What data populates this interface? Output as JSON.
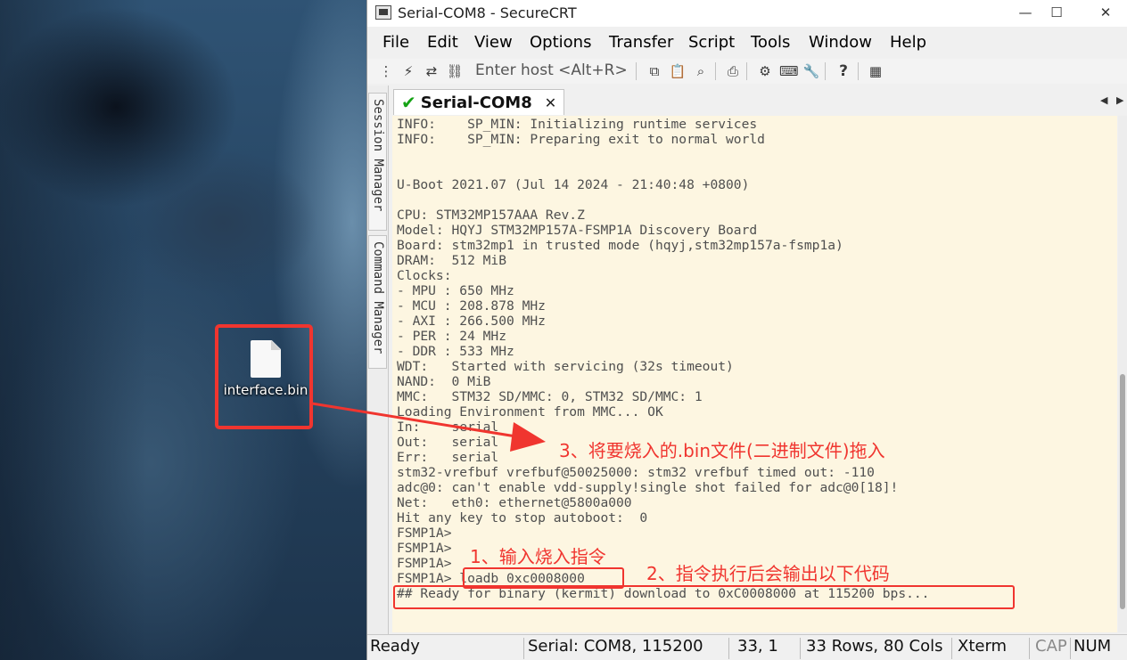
{
  "desktop": {
    "file_name": "interface.bin",
    "file_icon": "blank-file-icon"
  },
  "window": {
    "title": "Serial-COM8 - SecureCRT",
    "minimize_glyph": "—",
    "maximize_glyph": "☐",
    "close_glyph": "✕"
  },
  "menu": [
    "File",
    "Edit",
    "View",
    "Options",
    "Transfer",
    "Script",
    "Tools",
    "Window",
    "Help"
  ],
  "toolbar": {
    "host_placeholder": "Enter host <Alt+R>",
    "icons": {
      "connect": "⋮",
      "quick_connect": "⚡",
      "reconnect": "⇄",
      "disconnect": "⛓",
      "copy": "⧉",
      "paste": "📋",
      "find": "⌕",
      "print": "⎙",
      "settings": "⚙",
      "keymap": "⌨",
      "tool": "🔧",
      "help": "?",
      "sftp": "▦"
    }
  },
  "side_panel": {
    "session_manager": "Session Manager",
    "command_manager": "Command Manager"
  },
  "session_tab": {
    "label": "Serial-COM8",
    "check": "✔",
    "close": "✕"
  },
  "terminal": {
    "lines": [
      "INFO:    SP_MIN: Initializing runtime services",
      "INFO:    SP_MIN: Preparing exit to normal world",
      "",
      "",
      "U-Boot 2021.07 (Jul 14 2024 - 21:40:48 +0800)",
      "",
      "CPU: STM32MP157AAA Rev.Z",
      "Model: HQYJ STM32MP157A-FSMP1A Discovery Board",
      "Board: stm32mp1 in trusted mode (hqyj,stm32mp157a-fsmp1a)",
      "DRAM:  512 MiB",
      "Clocks:",
      "- MPU : 650 MHz",
      "- MCU : 208.878 MHz",
      "- AXI : 266.500 MHz",
      "- PER : 24 MHz",
      "- DDR : 533 MHz",
      "WDT:   Started with servicing (32s timeout)",
      "NAND:  0 MiB",
      "MMC:   STM32 SD/MMC: 0, STM32 SD/MMC: 1",
      "Loading Environment from MMC... OK",
      "In:    serial",
      "Out:   serial",
      "Err:   serial",
      "stm32-vrefbuf vrefbuf@50025000: stm32 vrefbuf timed out: -110",
      "adc@0: can't enable vdd-supply!single shot failed for adc@0[18]!",
      "Net:   eth0: ethernet@5800a000",
      "Hit any key to stop autoboot:  0",
      "FSMP1A>",
      "FSMP1A>",
      "FSMP1A>",
      "FSMP1A> loadb 0xc0008000",
      "## Ready for binary (kermit) download to 0xC0008000 at 115200 bps..."
    ]
  },
  "status": {
    "ready": "Ready",
    "serial": "Serial: COM8, 115200",
    "cursor": "33,  1",
    "size": "33 Rows, 80 Cols",
    "emulation": "Xterm",
    "cap": "CAP",
    "num": "NUM"
  },
  "annotations": {
    "step1": "1、输入烧入指令",
    "step2": "2、指令执行后会输出以下代码",
    "step3": "3、将要烧入的.bin文件(二进制文件)拖入"
  },
  "colors": {
    "annotation": "#f0352f",
    "terminal_bg": "#fdf6e1",
    "terminal_fg": "#4f4f4f",
    "connected_check": "#15a315"
  }
}
